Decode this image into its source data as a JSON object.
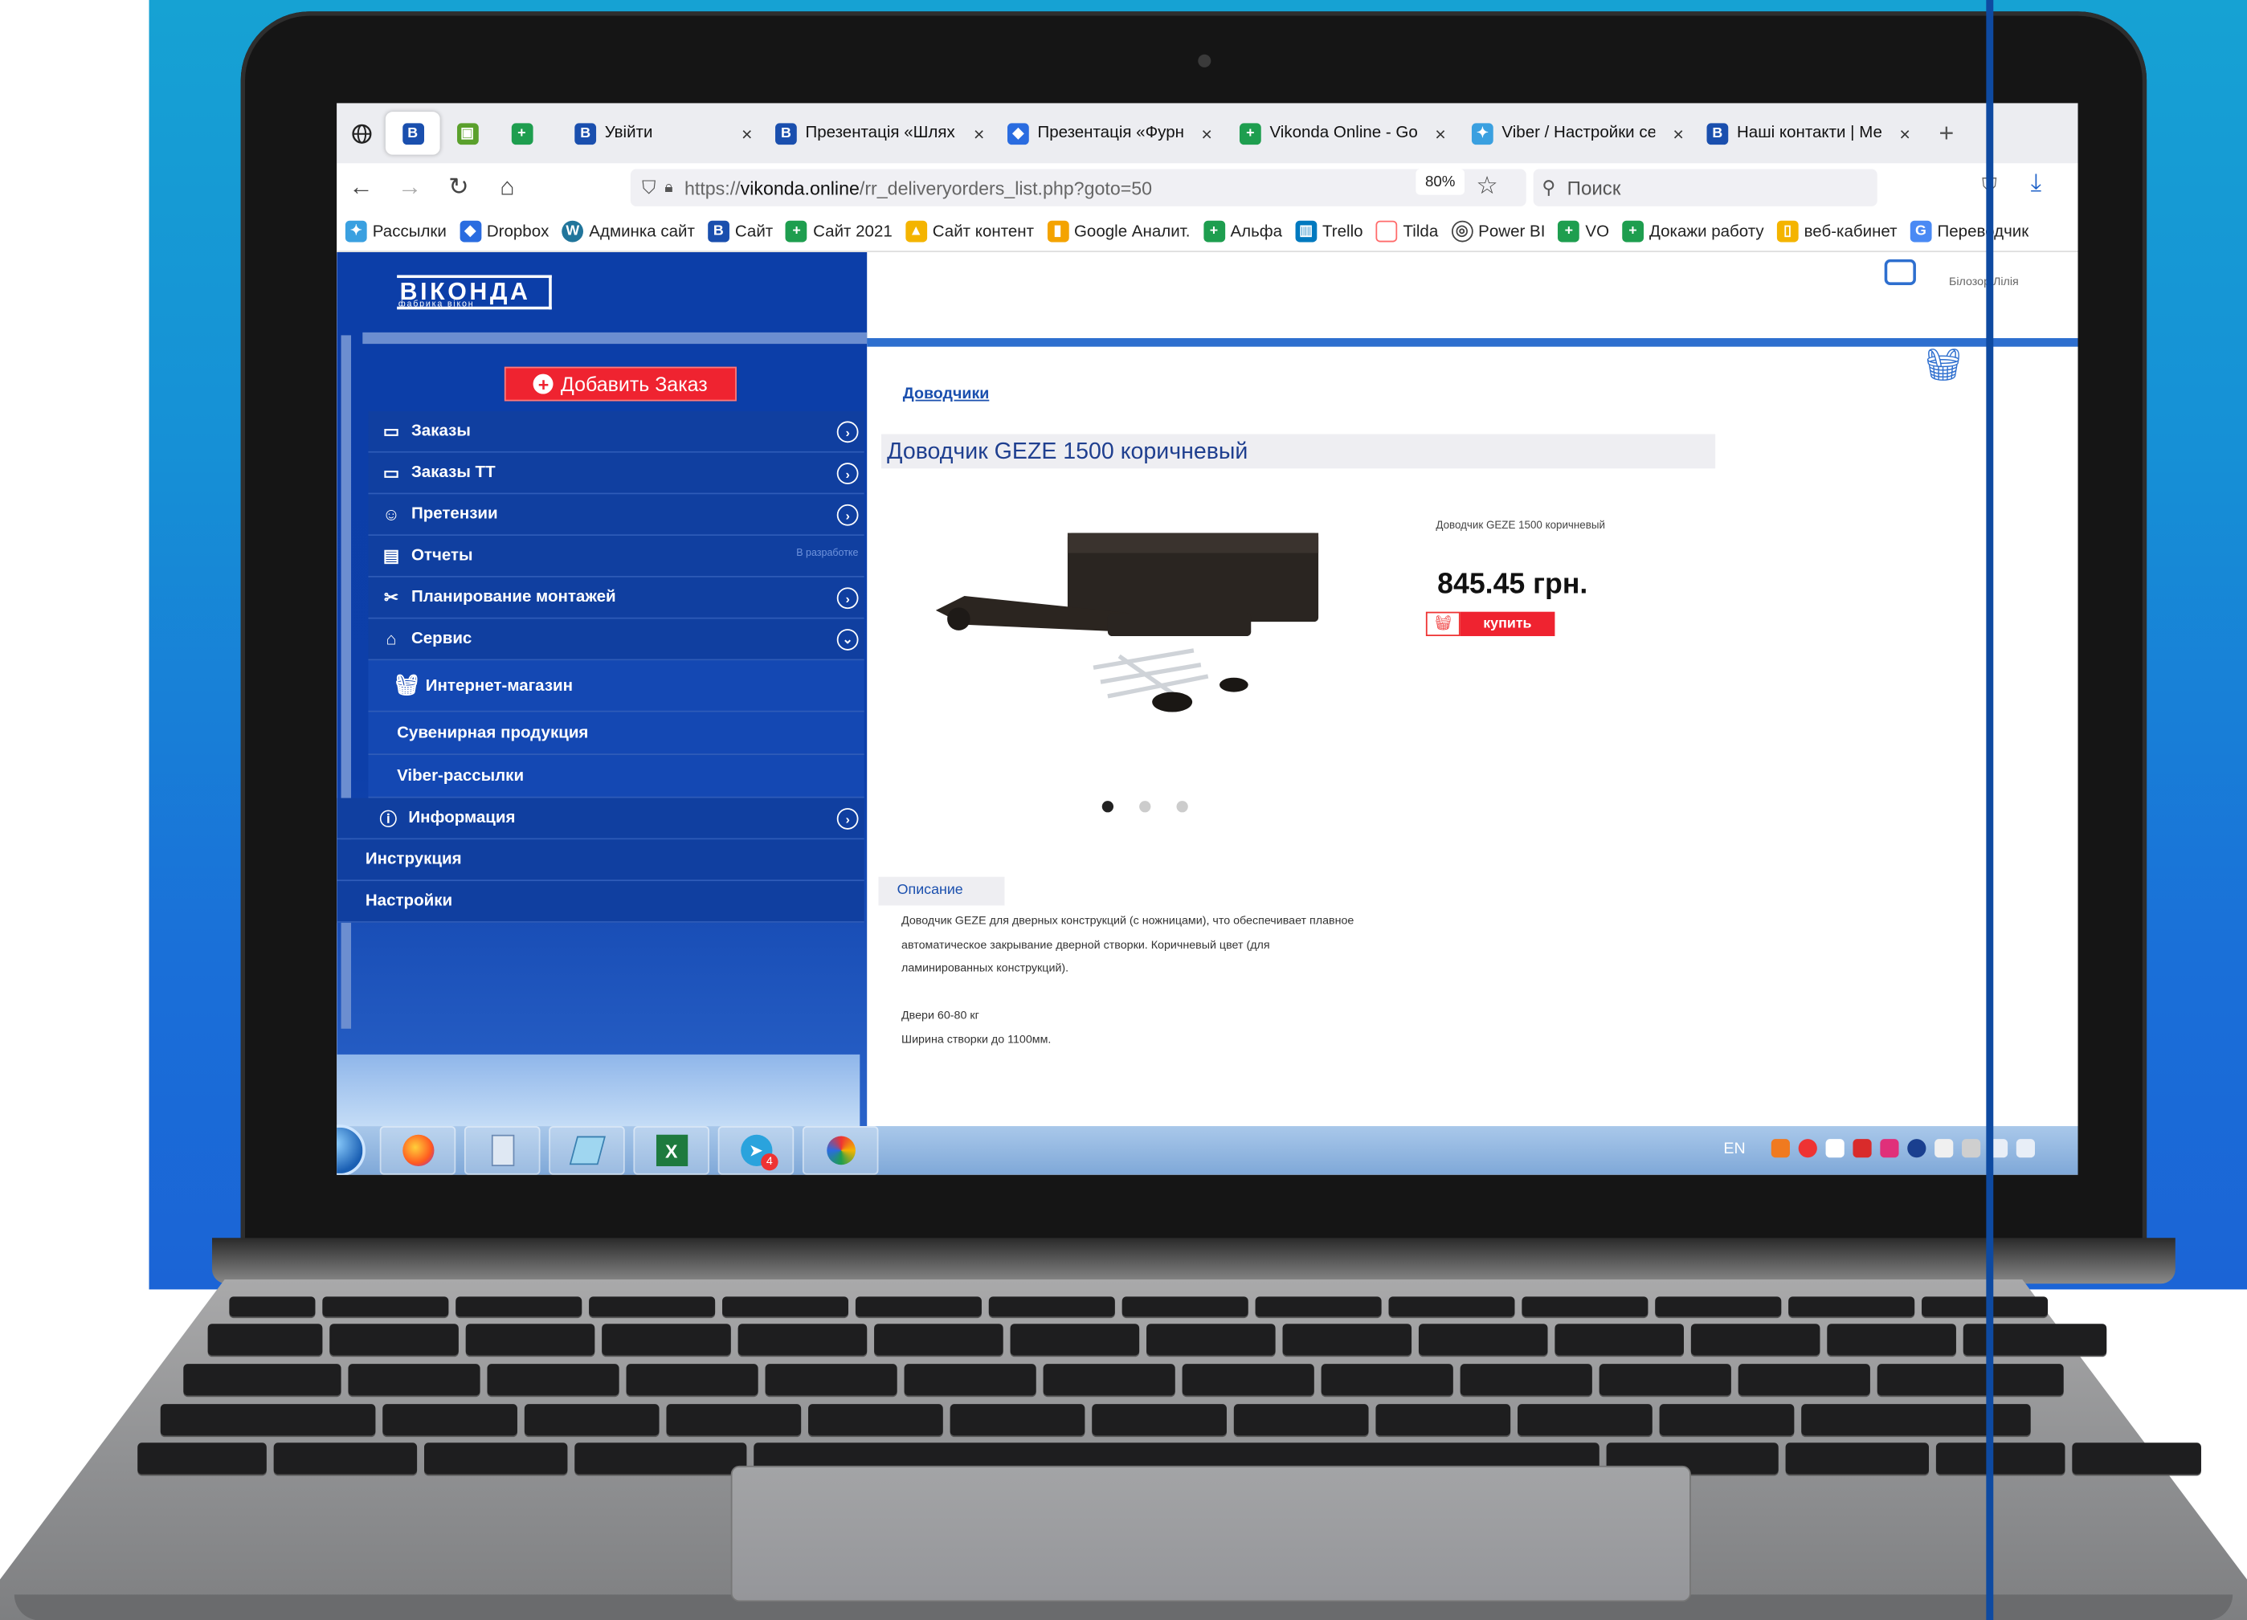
{
  "colors": {
    "brand_blue": "#0c3ea8",
    "accent_red": "#ef2330",
    "link_blue": "#1a4fae"
  },
  "browser": {
    "tabs": [
      {
        "label": "Увійти",
        "favicon": "vikonda-b-icon",
        "color": "#1a4fae",
        "close": "×"
      },
      {
        "label": "Презентація «Шлях в",
        "favicon": "vikonda-b-icon",
        "color": "#1a4fae",
        "close": "×"
      },
      {
        "label": "Презентація «Фурн",
        "favicon": "dropbox-icon",
        "color": "#2a6ce0",
        "close": "×"
      },
      {
        "label": "Vikonda Online - Go",
        "favicon": "sheets-icon",
        "color": "#1e9e4f",
        "close": "×"
      },
      {
        "label": "Viber / Настройки се",
        "favicon": "viber-icon",
        "color": "#3aa0e0",
        "close": "×"
      },
      {
        "label": "Наші контакти | Ме",
        "favicon": "vikonda-b-icon",
        "color": "#1a4fae",
        "close": "×"
      }
    ],
    "new_tab": "+",
    "url_prefix": "https://",
    "url_domain": "vikonda.online",
    "url_path": "/rr_deliveryorders_list.php?goto=50",
    "zoom": "80%",
    "search_placeholder": "Поиск",
    "bookmarks": [
      {
        "label": "Рассылки",
        "color": "#3aa0e0"
      },
      {
        "label": "Dropbox",
        "color": "#2a6ce0"
      },
      {
        "label": "Админка сайт",
        "color": "#21759b"
      },
      {
        "label": "Сайт",
        "color": "#1a4fae"
      },
      {
        "label": "Сайт 2021",
        "color": "#1e9e4f"
      },
      {
        "label": "Сайт контент",
        "color": "#f4b400"
      },
      {
        "label": "Google Аналит.",
        "color": "#f4a300"
      },
      {
        "label": "Альфа",
        "color": "#1e9e4f"
      },
      {
        "label": "Trello",
        "color": "#0079bf"
      },
      {
        "label": "Tilda",
        "color": "#ff6b6b"
      },
      {
        "label": "Power BI",
        "color": "#444444"
      },
      {
        "label": "VO",
        "color": "#1e9e4f"
      },
      {
        "label": "Докажи работу",
        "color": "#1e9e4f"
      },
      {
        "label": "веб-кабинет",
        "color": "#f4b400"
      },
      {
        "label": "Переводчик",
        "color": "#4a8af4"
      }
    ]
  },
  "sidebar": {
    "logo": "ВІКОНДА",
    "logo_sub": "фабрика вікон",
    "add_order": "Добавить Заказ",
    "items": [
      {
        "label": "Заказы",
        "icon": "briefcase-icon",
        "arrow": "›"
      },
      {
        "label": "Заказы ТТ",
        "icon": "briefcase-icon",
        "arrow": "›"
      },
      {
        "label": "Претензии",
        "icon": "smile-icon",
        "arrow": "›"
      },
      {
        "label": "Отчеты",
        "icon": "report-icon",
        "note": "В разработке"
      },
      {
        "label": "Планирование монтажей",
        "icon": "tools-icon",
        "arrow": "›"
      },
      {
        "label": "Сервис",
        "icon": "gift-icon",
        "arrow": "⌄"
      }
    ],
    "sub_items": [
      {
        "label": "Интернет-магазин",
        "icon": "basket-icon"
      },
      {
        "label": "Сувенирная продукция"
      },
      {
        "label": "Viber-рассылки"
      }
    ],
    "info": {
      "label": "Информация",
      "icon": "info-icon",
      "arrow": "›"
    },
    "bottom_items": [
      {
        "label": "Инструкция"
      },
      {
        "label": "Настройки"
      }
    ]
  },
  "header": {
    "user": "Білозор Лілія"
  },
  "product": {
    "breadcrumb": "Доводчики",
    "title": "Доводчик GEZE 1500 коричневый",
    "small_name": "Доводчик GEZE 1500 коричневый",
    "price": "845.45 грн.",
    "buy_label": "купить",
    "slides": 3,
    "active_slide": 1,
    "desc_tab": "Описание",
    "desc_lines": [
      "Доводчик GEZE для дверных конструкций (с ножницами), что обеспечивает плавное",
      "автоматическое закрывание дверной створки. Коричневый цвет (для",
      "ламинированных конструкций).",
      "",
      "Двери 60-80 кг",
      "Ширина створки до 1100мм."
    ]
  },
  "taskbar": {
    "lang": "EN",
    "apps": [
      "firefox-icon",
      "calculator-icon",
      "notepad-icon",
      "excel-icon",
      "telegram-icon",
      "paint-icon"
    ],
    "telegram_badge": "4"
  }
}
